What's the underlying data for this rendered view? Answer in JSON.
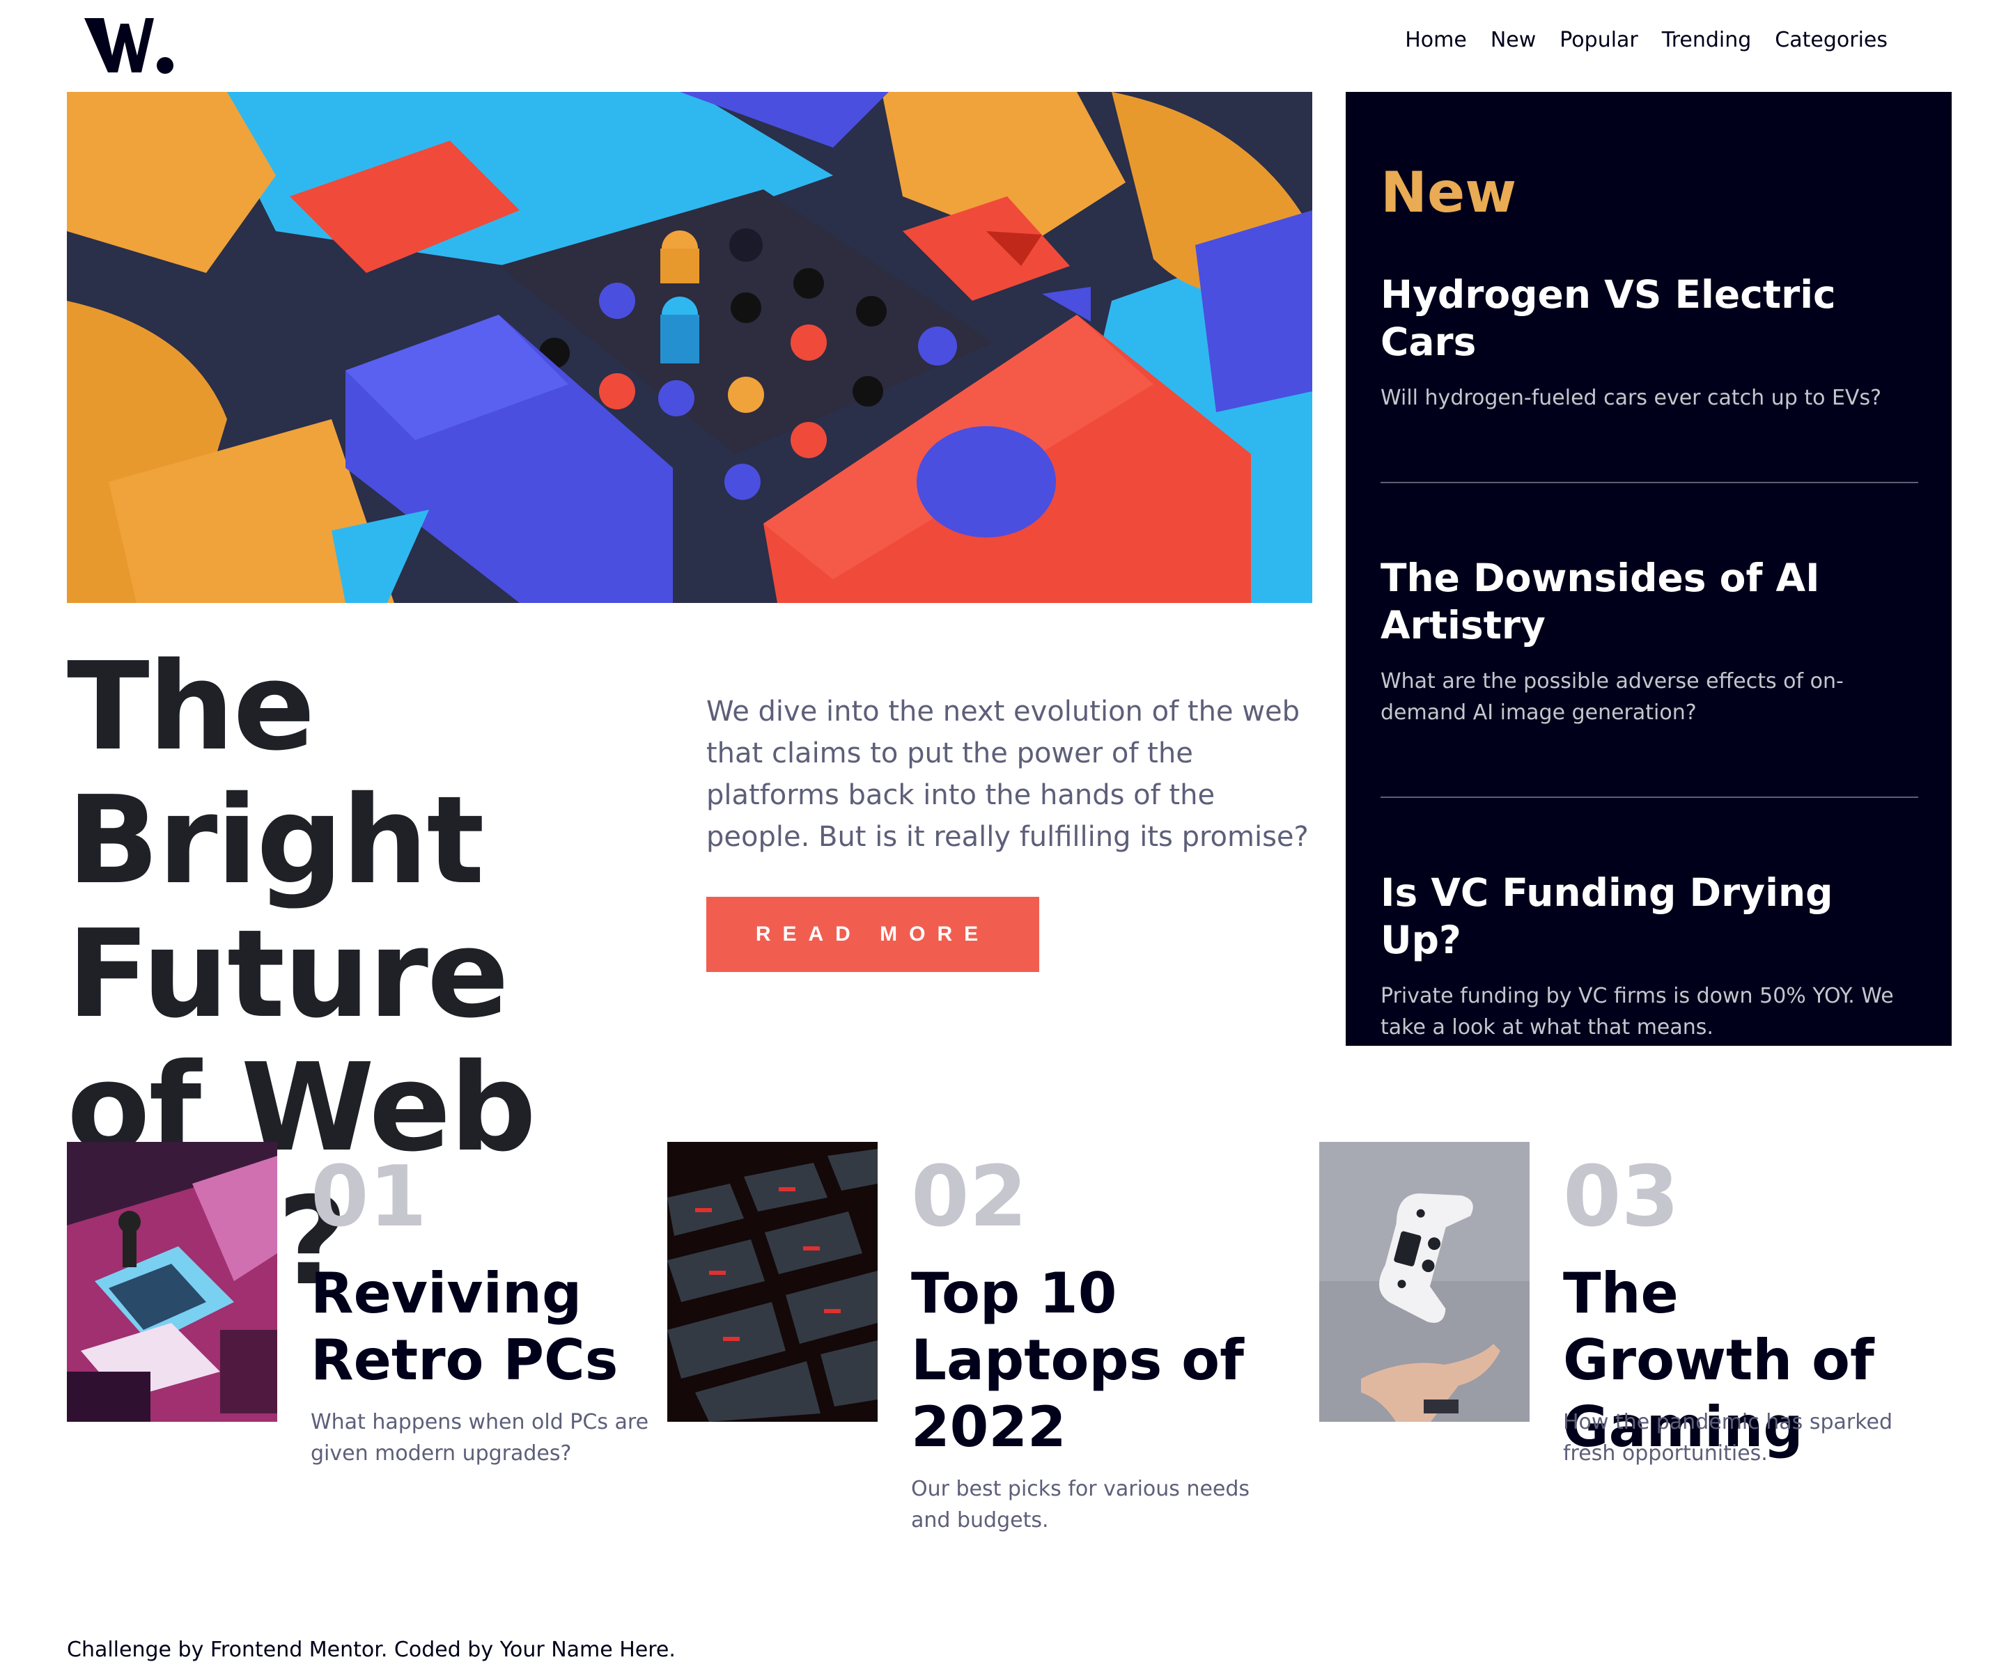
{
  "header": {
    "logo_text": "W.",
    "nav": [
      "Home",
      "New",
      "Popular",
      "Trending",
      "Categories"
    ]
  },
  "hero": {
    "title": "The Bright Future of Web 3.0?",
    "description": "We dive into the next evolution of the web that claims to put the power of the platforms back into the hands of the people. But is it really fulfilling its promise?",
    "button_label": "READ MORE"
  },
  "new_panel": {
    "title": "New",
    "items": [
      {
        "title": "Hydrogen VS Electric Cars",
        "text": "Will hydrogen-fueled cars ever catch up to EVs?"
      },
      {
        "title": "The Downsides of AI Artistry",
        "text": "What are the possible adverse effects of on-demand AI image generation?"
      },
      {
        "title": "Is VC Funding Drying Up?",
        "text": "Private funding by VC firms is down 50% YOY. We take a look at what that means."
      }
    ]
  },
  "cards": [
    {
      "number": "01",
      "title": "Reviving Retro PCs",
      "text": "What happens when old PCs are given modern upgrades?"
    },
    {
      "number": "02",
      "title": "Top 10 Laptops of 2022",
      "text": "Our best picks for various needs and budgets."
    },
    {
      "number": "03",
      "title": "The Growth of Gaming",
      "text": "How the pandemic has sparked fresh opportunities."
    }
  ],
  "footer": {
    "text": "Challenge by Frontend Mentor. Coded by Your Name Here."
  },
  "colors": {
    "accent_red": "#f15e50",
    "accent_orange": "#e9ab53",
    "dark_navy": "#00001a",
    "grayish_blue": "#5d5f79",
    "light_gray": "#c5c6ce"
  }
}
